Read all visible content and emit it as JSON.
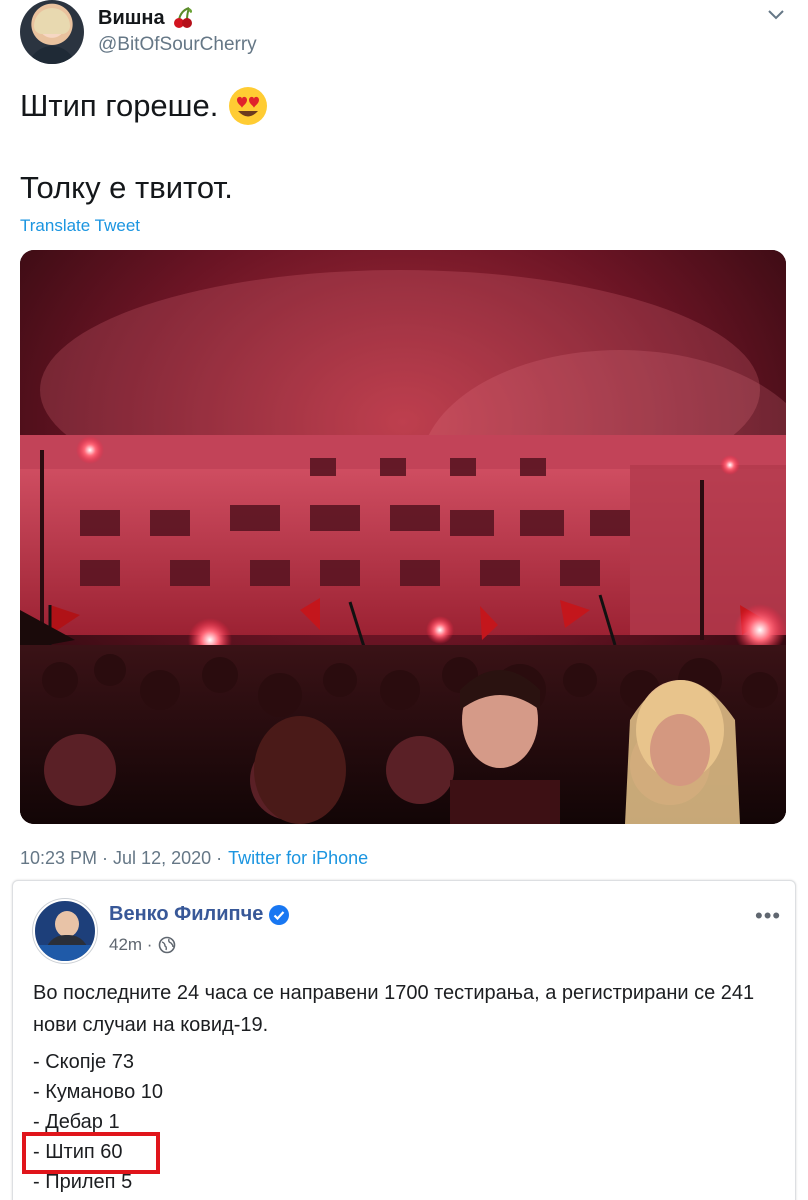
{
  "tweet": {
    "display_name": "Вишна",
    "name_emoji": "cherry-emoji",
    "handle": "@BitOfSourCherry",
    "text_line1": "Штип гореше.",
    "text_line1_emoji": "heart-eyes-emoji",
    "text_line2": "Толку е твитот.",
    "translate_link": "Translate Tweet",
    "timestamp": "10:23 PM · Jul 12, 2020 ·",
    "source": "Twitter for iPhone"
  },
  "facebook_post": {
    "author": "Венко Филипче",
    "verified": true,
    "time": "42m ·",
    "body": "Во последните 24 часа се направени 1700 тестирања, а регистрирани се 241 нови случаи на ковид-19.",
    "list": [
      "- Скопје 73",
      "- Куманово 10",
      "- Дебар 1",
      "- Штип 60",
      "- Прилеп 5"
    ],
    "highlighted_item": "- Штип 60"
  },
  "colors": {
    "twitter_blue": "#1b95e0",
    "facebook_blue": "#385898",
    "highlight_red": "#e0151b"
  }
}
